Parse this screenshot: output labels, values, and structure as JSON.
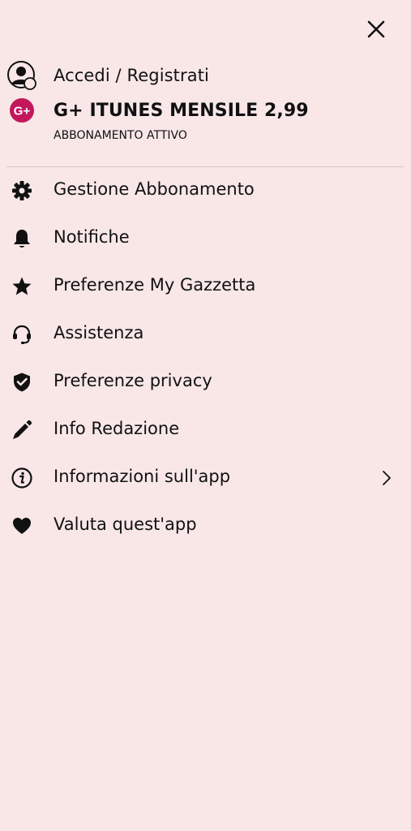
{
  "header": {
    "close_icon": "close-icon"
  },
  "account": {
    "login_label": "Accedi / Registrati",
    "login_icon": "user-avatar-icon",
    "subscription_name": "G+ ITUNES MENSILE 2,99",
    "subscription_badge_text": "G+",
    "subscription_badge_color": "#c2185b",
    "subscription_status": "ABBONAMENTO ATTIVO"
  },
  "menu": {
    "items": [
      {
        "label": "Gestione Abbonamento",
        "icon": "gear-icon"
      },
      {
        "label": "Notifiche",
        "icon": "bell-icon"
      },
      {
        "label": "Preferenze My Gazzetta",
        "icon": "star-icon"
      },
      {
        "label": "Assistenza",
        "icon": "headset-icon"
      },
      {
        "label": "Preferenze privacy",
        "icon": "shield-check-icon"
      },
      {
        "label": "Info Redazione",
        "icon": "pencil-icon"
      },
      {
        "label": "Informazioni sull'app",
        "icon": "info-icon",
        "has_chevron": true
      },
      {
        "label": "Valuta quest'app",
        "icon": "heart-icon"
      }
    ]
  },
  "colors": {
    "background": "#f9e7e8",
    "text": "#111111",
    "accent": "#c2185b"
  }
}
